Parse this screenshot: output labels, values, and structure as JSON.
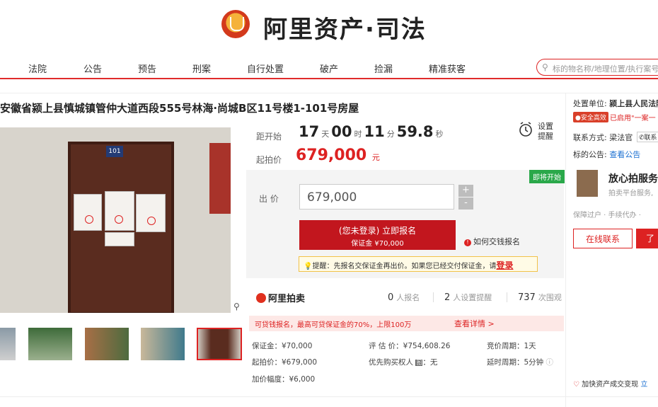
{
  "header": {
    "logo_text": "阿里资产·司法"
  },
  "nav": {
    "items": [
      "法院",
      "公告",
      "预告",
      "刑案",
      "自行处置",
      "破产",
      "捡漏",
      "精准获客"
    ]
  },
  "search": {
    "placeholder": "标的物名称/地理位置/执行案号"
  },
  "listing": {
    "title": "安徽省颍上县慎城镇管仲大道西段555号林海·尚城B区11号楼1-101号房屋",
    "door_number": "101"
  },
  "countdown": {
    "label": "距开始",
    "days": "17",
    "days_unit": "天",
    "hours": "00",
    "hours_unit": "时",
    "minutes": "11",
    "minutes_unit": "分",
    "seconds": "59.8",
    "seconds_unit": "秒",
    "reminder_label": "设置提醒"
  },
  "price": {
    "start_label": "起拍价",
    "start_value": "679,000",
    "unit": "元"
  },
  "bid": {
    "status_tag": "即将开始",
    "label": "出 价",
    "input_value": "679,000",
    "plus": "+",
    "minus": "-",
    "signup_line1": "(您未登录) 立即报名",
    "signup_line2": "保证金 ¥70,000",
    "howto": "如何交钱报名",
    "notice_prefix": "提醒：先报名交保证金再出价。如果您已经交付保证金，请",
    "notice_login": "登录"
  },
  "stats": {
    "brand": "阿里拍卖",
    "signups": "0",
    "signups_label": "人报名",
    "reminders": "2",
    "reminders_label": "人设置提醒",
    "views": "737",
    "views_label": "次围观"
  },
  "loan": {
    "text": "可贷钱报名，最高可贷保证金的70%，上限100万",
    "link": "查看详情 >"
  },
  "details": {
    "deposit": "保证金：¥70,000",
    "appraisal": "评 估 价：¥754,608.26",
    "cycle": "竞价周期：1天",
    "start": "起拍价：¥679,000",
    "priority": "优先购买权人",
    "priority_badge": "图",
    "priority_value": "：无",
    "delay": "延时周期：5分钟",
    "increment": "加价幅度：¥6,000"
  },
  "right": {
    "org_label": "处置单位:",
    "org_name": "颍上县人民法院",
    "safe_badge": "安全高效",
    "safe_text": "已启用\"一案一",
    "contact_label": "联系方式:",
    "contact_name": "梁法官",
    "tel_chip": "联系",
    "notice_label": "标的公告:",
    "notice_link": "查看公告",
    "service_title": "放心拍服务",
    "service_sub": "拍卖平台服务,",
    "service_tags": "保障过户 · 手续代办 ·",
    "contact_button": "在线联系",
    "more_button": "了",
    "accel_text": "加快资产成交变现",
    "accel_link": "立"
  },
  "colors": {
    "brand_red": "#d22",
    "signup_red": "#c2161e",
    "tag_green": "#2aa84a"
  }
}
